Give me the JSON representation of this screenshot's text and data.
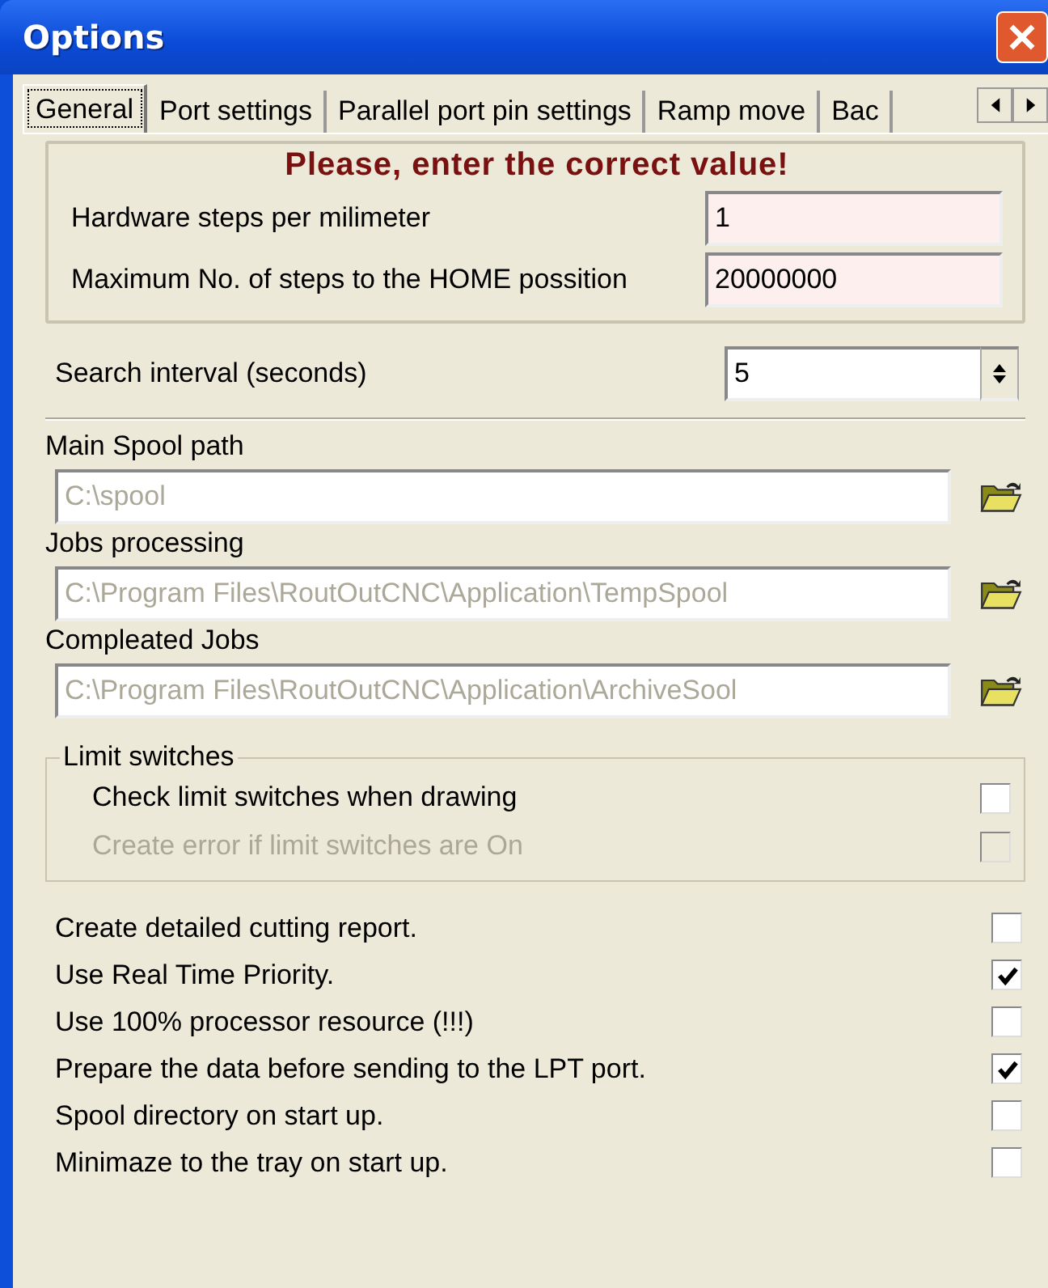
{
  "window": {
    "title": "Options"
  },
  "tabs": [
    {
      "label": "General",
      "selected": true
    },
    {
      "label": "Port settings",
      "selected": false
    },
    {
      "label": "Parallel port pin settings",
      "selected": false
    },
    {
      "label": "Ramp move",
      "selected": false
    },
    {
      "label": "Bac",
      "selected": false
    }
  ],
  "required_group": {
    "heading": "Please, enter the correct value!",
    "fields": [
      {
        "label": "Hardware steps per milimeter",
        "value": "1"
      },
      {
        "label": "Maximum No. of steps to the HOME possition",
        "value": "20000000"
      }
    ]
  },
  "search_interval": {
    "label": "Search interval (seconds)",
    "value": "5"
  },
  "paths": [
    {
      "label": "Main Spool path",
      "value": "C:\\spool",
      "disabled": true
    },
    {
      "label": "Jobs processing",
      "value": "C:\\Program Files\\RoutOutCNC\\Application\\TempSpool",
      "disabled": true
    },
    {
      "label": "Compleated Jobs",
      "value": "C:\\Program Files\\RoutOutCNC\\Application\\ArchiveSool",
      "disabled": true
    }
  ],
  "limit_switches": {
    "title": "Limit switches",
    "options": [
      {
        "label": "Check limit switches when drawing",
        "checked": false,
        "disabled": false
      },
      {
        "label": "Create error if limit switches are On",
        "checked": false,
        "disabled": true
      }
    ]
  },
  "options": [
    {
      "label": "Create detailed cutting report.",
      "checked": false,
      "disabled": false
    },
    {
      "label": "Use Real Time Priority.",
      "checked": true,
      "disabled": false
    },
    {
      "label": "Use 100% processor resource (!!!)",
      "checked": false,
      "disabled": false
    },
    {
      "label": "Prepare the data before sending to the LPT port.",
      "checked": true,
      "disabled": false
    },
    {
      "label": "Spool directory on start up.",
      "checked": false,
      "disabled": false
    },
    {
      "label": "Minimaze to the tray on start up.",
      "checked": false,
      "disabled": false
    }
  ]
}
